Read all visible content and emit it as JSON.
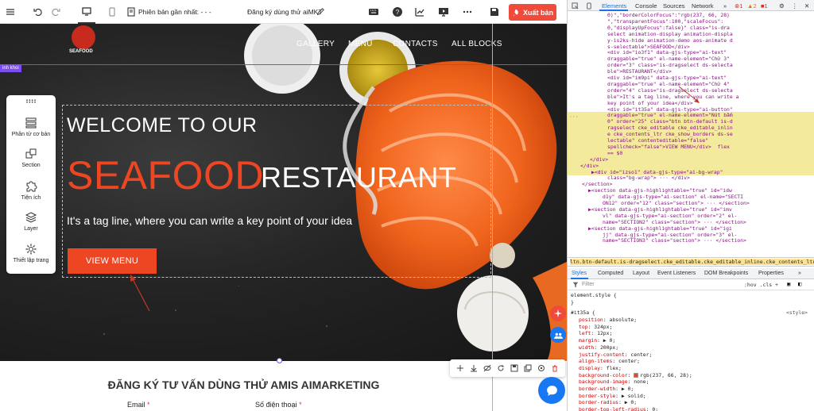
{
  "toolbar": {
    "version_label": "Phiên bản gần nhất: - - -",
    "page_title": "Đăng ký dùng thử aiMKT",
    "publish_label": "Xuất bản"
  },
  "canvas": {
    "logo_text": "SEAFOOD",
    "nav": [
      "GALLERY",
      "MENU",
      "CONTACTS",
      "ALL BLOCKS"
    ],
    "section_tag": "inh khoi",
    "hero": {
      "welcome": "WELCOME TO OUR",
      "seafood": "SEAFOOD",
      "restaurant": "RESTAURANT",
      "tagline": "It's a tag line, where you can write a key point of your idea",
      "button": "VIEW MENU"
    },
    "form": {
      "title": "ĐĂNG KÝ TƯ VẤN DÙNG THỬ AMIS AIMARKETING",
      "email_label": "Email",
      "phone_label": "Số điện thoại",
      "required_mark": "*"
    }
  },
  "left_panel": {
    "items": [
      "Phần tử cơ bản",
      "Section",
      "Tiện ích",
      "Layer",
      "Thiết lập trang"
    ]
  },
  "devtools": {
    "tabs": [
      "Elements",
      "Console",
      "Sources",
      "Network"
    ],
    "badges": {
      "errors": "1",
      "warnings": "2",
      "issues": "1"
    },
    "dom_lines": [
      "0)\",\"borderColorFocus\":\"rgb(237, 66, 28)",
      "\",\"transparentFocus\":100,\"scaleFocus\":",
      "0,\"displayUpFocus\":false}\" class=\"is-dra",
      "select animation-display animation-displa",
      "y-is2ks-hide animation-demo aos-animate d",
      "s-selectable\">SEAFOOD</div>",
      "<div id=\"io3f1\" data-gjs-type=\"ai-text\"",
      "draggable=\"true\" el-name-element=\"Chữ 3\"",
      "order=\"3\" class=\"is-dragselect ds-selecta",
      "ble\">RESTAURANT</div>",
      "<div id=\"im9pi\" data-gjs-type=\"ai-text\"",
      "draggable=\"true\" el-name-element=\"Chữ 4\"",
      "order=\"4\" class=\"is-dragselect ds-selecta",
      "ble\">It's a tag line, where you can write a",
      "key point of your idea</div>",
      "<div id=\"it35a\" data-gjs-type=\"ai-button\"",
      "draggable=\"true\" el-name-element=\"Nút bấm",
      "0\" order=\"25\" class=\"btn btn-default is-d",
      "ragselect cke_editable cke_editable_inlin",
      "e cke_contents_ltr cke_show_borders ds-se",
      "lectable\" contenteditable=\"false\"",
      "spellcheck=\"false\">VIEW MENU</div>  flex",
      "== $0",
      "</div>",
      "</div>",
      "▶<div id=\"izso1\" data-gjs-type=\"ai-bg-wrap\"",
      "class=\"bg-wrap\"> ··· </div>",
      "</section>",
      "▶<section data-gjs-highlightable=\"true\" id=\"idw",
      "d1y\" data-gjs-type=\"ai-section\" el-name=\"SECTI",
      "ON12\" order=\"12\" class=\"section\"> ··· </section>",
      "▶<section data-gjs-highlightable=\"true\" id=\"imv",
      "vl\" data-gjs-type=\"ai-section\" order=\"2\" el-",
      "name=\"SECTION2\" class=\"section\"> ··· </section>",
      "▶<section data-gjs-highlightable=\"true\" id=\"igi",
      "jj\" data-gjs-type=\"ai-section\" order=\"3\" el-",
      "name=\"SECTION3\" class=\"section\"> ··· </section>"
    ],
    "breadcrumb": "ltn.btn-default.is-dragselect.cke_editable.cke_editable_inline.cke_contents_ltr.cke_show_bor",
    "styles_tabs": [
      "Styles",
      "Computed",
      "Layout",
      "Event Listeners",
      "DOM Breakpoints",
      "Properties"
    ],
    "filter_placeholder": "Filter",
    "filter_right": ":hov .cls +",
    "element_style": "element.style {",
    "close_brace": "}",
    "rule_selector": "#it35a {",
    "rule_source": "<style>",
    "props": [
      [
        "position",
        "absolute;"
      ],
      [
        "top",
        "324px;"
      ],
      [
        "left",
        "12px;"
      ],
      [
        "margin",
        "▶ 0;"
      ],
      [
        "width",
        "200px;"
      ],
      [
        "justify-content",
        "center;"
      ],
      [
        "align-items",
        "center;"
      ],
      [
        "display",
        "flex;"
      ],
      [
        "background-color",
        "rgb(237, 66, 28);"
      ],
      [
        "background-image",
        "none;"
      ],
      [
        "border-width",
        "▶ 0;"
      ],
      [
        "border-style",
        "▶ solid;"
      ],
      [
        "border-radius",
        "▶ 0;"
      ],
      [
        "border-top-left-radius",
        "0;"
      ]
    ]
  },
  "colors": {
    "accent": "#ee4522",
    "publish": "#f04a3a",
    "editor_purple": "#7b4cf0",
    "devtools_blue": "#1a73e8"
  }
}
